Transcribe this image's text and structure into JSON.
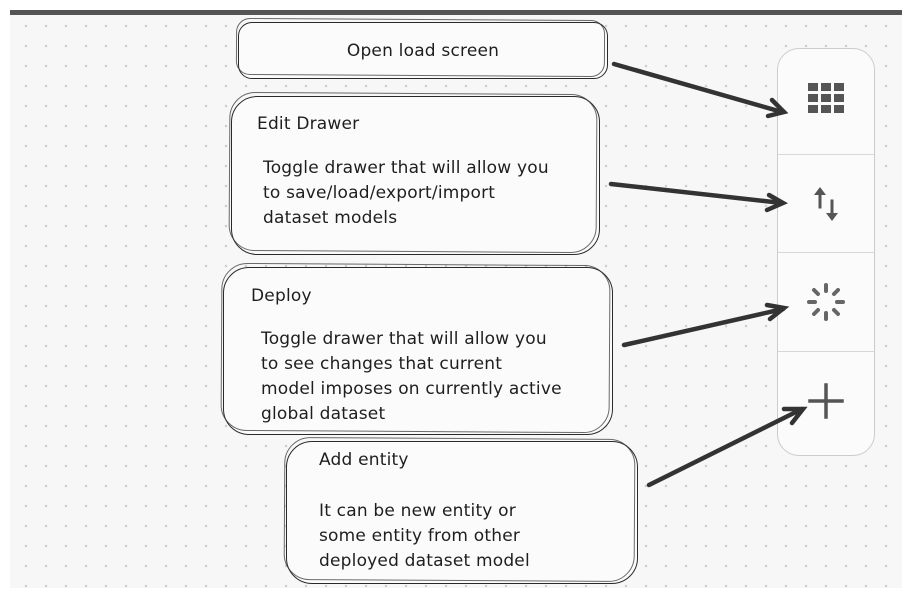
{
  "notes": {
    "load": {
      "title": "Open load screen"
    },
    "edit": {
      "title": "Edit Drawer",
      "body": "Toggle drawer that will allow you\nto save/load/export/import\ndataset models"
    },
    "deploy": {
      "title": "Deploy",
      "body": "Toggle drawer that will allow you\nto see changes that current\nmodel imposes on currently active\nglobal dataset"
    },
    "add": {
      "title": "Add entity",
      "body": "It can be new entity or\nsome entity from other\ndeployed dataset model"
    }
  },
  "toolbar": {
    "buttons": [
      {
        "icon": "grid-icon"
      },
      {
        "icon": "swap-vertical-icon"
      },
      {
        "icon": "deploy-spinner-icon"
      },
      {
        "icon": "plus-icon"
      }
    ]
  },
  "colors": {
    "ink": "#1e1e1e",
    "canvas": "#f7f7f7",
    "icon": "#555555"
  }
}
